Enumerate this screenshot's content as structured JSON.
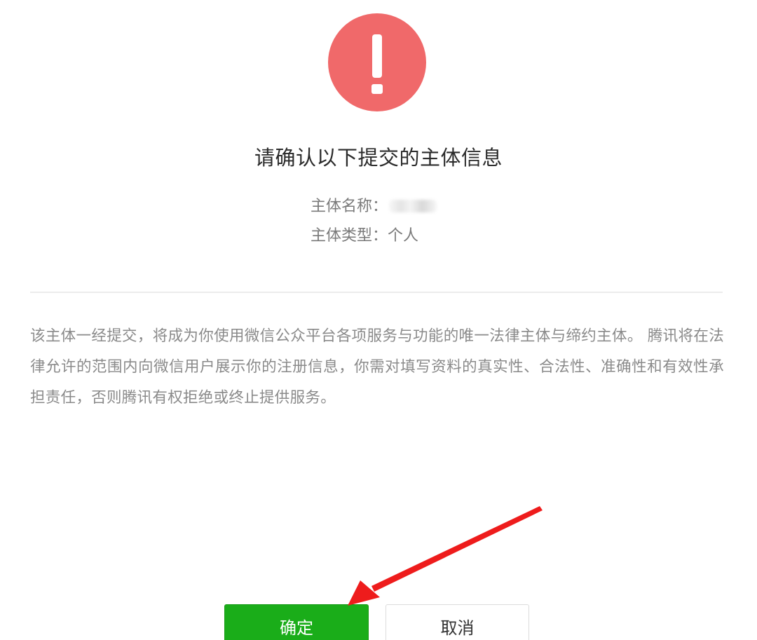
{
  "dialog": {
    "title": "请确认以下提交的主体信息",
    "info": {
      "name_label": "主体名称：",
      "type_label": "主体类型：",
      "type_value": "个人"
    },
    "notice": "该主体一经提交，将成为你使用微信公众平台各项服务与功能的唯一法律主体与缔约主体。 腾讯将在法律允许的范围内向微信用户展示你的注册信息，你需对填写资料的真实性、合法性、准确性和有效性承担责任，否则腾讯有权拒绝或终止提供服务。",
    "buttons": {
      "confirm_label": "确定",
      "cancel_label": "取消"
    }
  },
  "colors": {
    "warning": "#f0696a",
    "primary_button": "#1aad19",
    "annotation_arrow": "#ee1c1c"
  },
  "icons": {
    "warning": "exclamation-circle-icon",
    "annotation": "red-arrow-annotation"
  }
}
